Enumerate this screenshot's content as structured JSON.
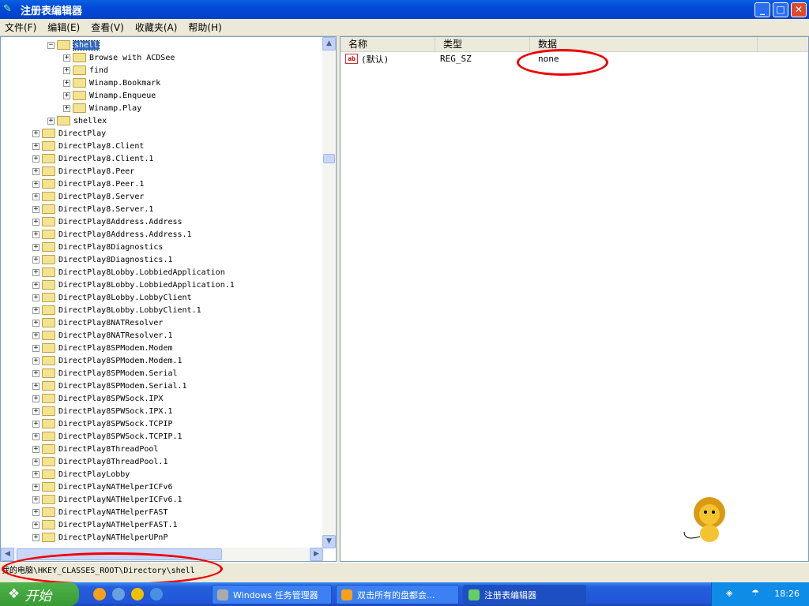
{
  "window": {
    "title": "注册表编辑器",
    "minimize": "_",
    "maximize": "□",
    "close": "✕"
  },
  "menu": [
    "文件(F)",
    "编辑(E)",
    "查看(V)",
    "收藏夹(A)",
    "帮助(H)"
  ],
  "tree": {
    "selected": "shell",
    "items": [
      {
        "label": "shell",
        "level": 2,
        "expanded": true,
        "selected": true
      },
      {
        "label": "Browse with ACDSee",
        "level": 3
      },
      {
        "label": "find",
        "level": 3
      },
      {
        "label": "Winamp.Bookmark",
        "level": 3
      },
      {
        "label": "Winamp.Enqueue",
        "level": 3
      },
      {
        "label": "Winamp.Play",
        "level": 3
      },
      {
        "label": "shellex",
        "level": 2
      },
      {
        "label": "DirectPlay",
        "level": 1
      },
      {
        "label": "DirectPlay8.Client",
        "level": 1
      },
      {
        "label": "DirectPlay8.Client.1",
        "level": 1
      },
      {
        "label": "DirectPlay8.Peer",
        "level": 1
      },
      {
        "label": "DirectPlay8.Peer.1",
        "level": 1
      },
      {
        "label": "DirectPlay8.Server",
        "level": 1
      },
      {
        "label": "DirectPlay8.Server.1",
        "level": 1
      },
      {
        "label": "DirectPlay8Address.Address",
        "level": 1
      },
      {
        "label": "DirectPlay8Address.Address.1",
        "level": 1
      },
      {
        "label": "DirectPlay8Diagnostics",
        "level": 1
      },
      {
        "label": "DirectPlay8Diagnostics.1",
        "level": 1
      },
      {
        "label": "DirectPlay8Lobby.LobbiedApplication",
        "level": 1
      },
      {
        "label": "DirectPlay8Lobby.LobbiedApplication.1",
        "level": 1
      },
      {
        "label": "DirectPlay8Lobby.LobbyClient",
        "level": 1
      },
      {
        "label": "DirectPlay8Lobby.LobbyClient.1",
        "level": 1
      },
      {
        "label": "DirectPlay8NATResolver",
        "level": 1
      },
      {
        "label": "DirectPlay8NATResolver.1",
        "level": 1
      },
      {
        "label": "DirectPlay8SPModem.Modem",
        "level": 1
      },
      {
        "label": "DirectPlay8SPModem.Modem.1",
        "level": 1
      },
      {
        "label": "DirectPlay8SPModem.Serial",
        "level": 1
      },
      {
        "label": "DirectPlay8SPModem.Serial.1",
        "level": 1
      },
      {
        "label": "DirectPlay8SPWSock.IPX",
        "level": 1
      },
      {
        "label": "DirectPlay8SPWSock.IPX.1",
        "level": 1
      },
      {
        "label": "DirectPlay8SPWSock.TCPIP",
        "level": 1
      },
      {
        "label": "DirectPlay8SPWSock.TCPIP.1",
        "level": 1
      },
      {
        "label": "DirectPlay8ThreadPool",
        "level": 1
      },
      {
        "label": "DirectPlay8ThreadPool.1",
        "level": 1
      },
      {
        "label": "DirectPlayLobby",
        "level": 1
      },
      {
        "label": "DirectPlayNATHelperICFv6",
        "level": 1
      },
      {
        "label": "DirectPlayNATHelperICFv6.1",
        "level": 1
      },
      {
        "label": "DirectPlayNATHelperFAST",
        "level": 1
      },
      {
        "label": "DirectPlayNATHelperFAST.1",
        "level": 1
      },
      {
        "label": "DirectPlayNATHelperUPnP",
        "level": 1
      }
    ]
  },
  "values": {
    "columns": [
      "名称",
      "类型",
      "数据"
    ],
    "rows": [
      {
        "name": "(默认)",
        "type": "REG_SZ",
        "data": "none",
        "icon": "string-value-icon"
      }
    ]
  },
  "status": {
    "path": "我的电脑\\HKEY_CLASSES_ROOT\\Directory\\shell"
  },
  "taskbar": {
    "start": "开始",
    "tasks": [
      {
        "label": "Windows 任务管理器"
      },
      {
        "label": "双击所有的盘都会..."
      },
      {
        "label": "注册表编辑器",
        "active": true
      }
    ],
    "clock": "18:26"
  },
  "colors": {
    "titlebar": "#0349d8",
    "selection": "#316ac5",
    "annotation": "#e00000",
    "tray": "#0f8be8"
  }
}
